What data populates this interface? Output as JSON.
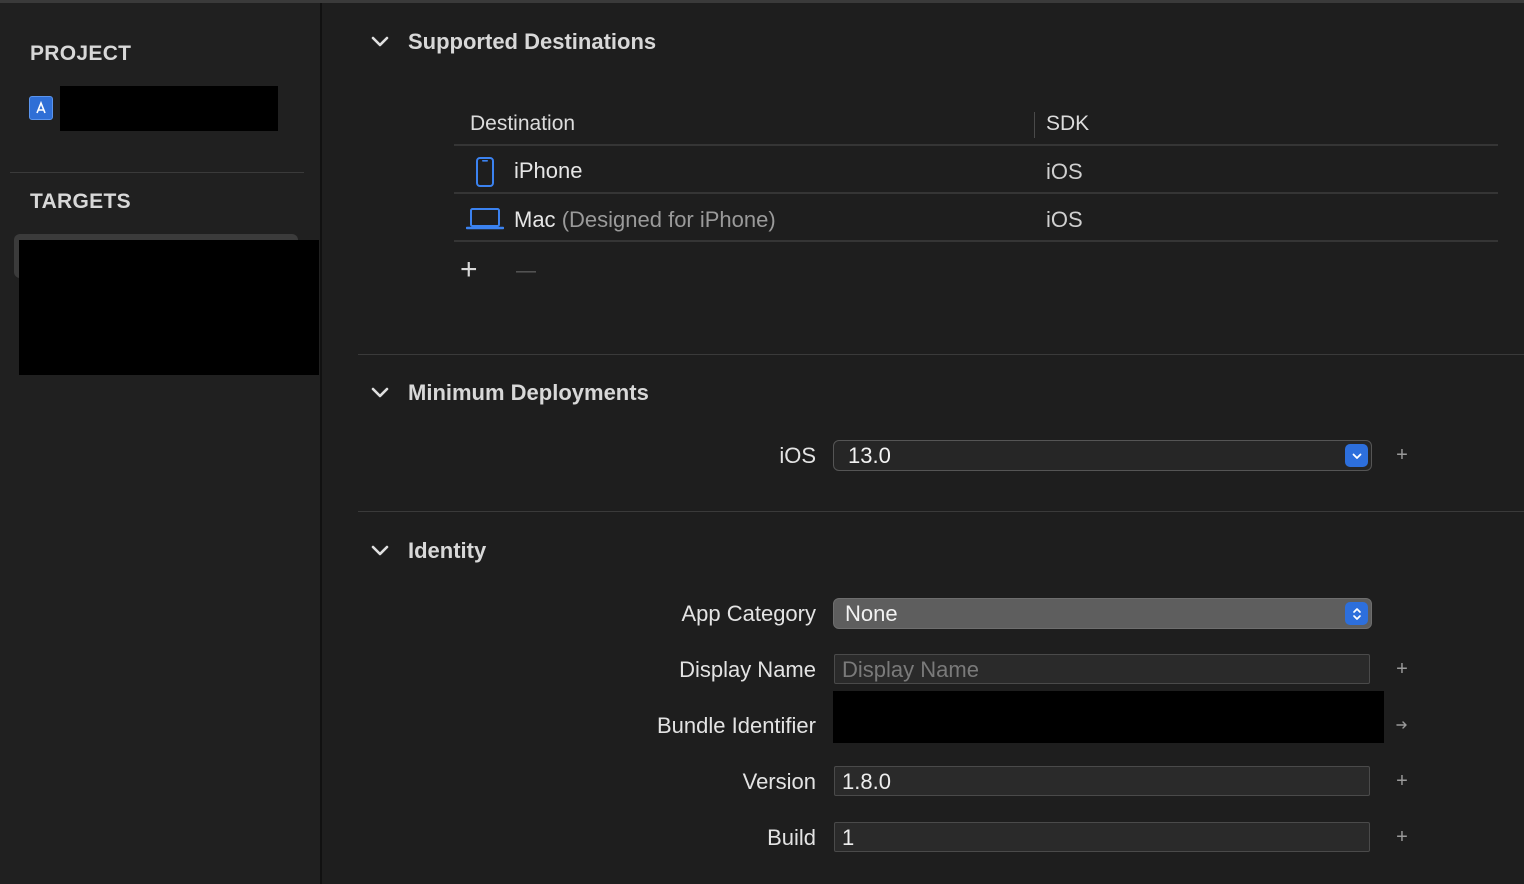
{
  "sidebar": {
    "project_title": "PROJECT",
    "targets_title": "TARGETS"
  },
  "supported_destinations": {
    "title": "Supported Destinations",
    "columns": [
      "Destination",
      "SDK"
    ],
    "rows": [
      {
        "icon": "iphone-icon",
        "name": "iPhone",
        "detail": "",
        "sdk": "iOS"
      },
      {
        "icon": "laptop-icon",
        "name": "Mac",
        "detail": "(Designed for iPhone)",
        "sdk": "iOS"
      }
    ],
    "add_symbol": "+",
    "remove_symbol": "—"
  },
  "minimum_deployments": {
    "title": "Minimum Deployments",
    "ios_label": "iOS",
    "ios_value": "13.0"
  },
  "identity": {
    "title": "Identity",
    "app_category_label": "App Category",
    "app_category_value": "None",
    "display_name_label": "Display Name",
    "display_name_placeholder": "Display Name",
    "bundle_identifier_label": "Bundle Identifier",
    "version_label": "Version",
    "version_value": "1.8.0",
    "build_label": "Build",
    "build_value": "1"
  },
  "colors": {
    "accent": "#2d6fdc",
    "background": "#1e1e1e",
    "sidebar": "#202020"
  }
}
